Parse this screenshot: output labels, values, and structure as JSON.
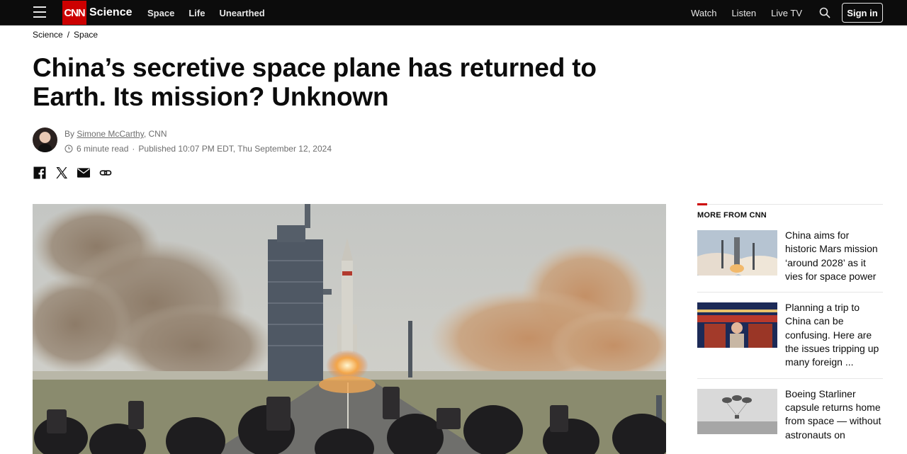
{
  "nav": {
    "logo": "CNN",
    "section": "Science",
    "links": [
      "Space",
      "Life",
      "Unearthed"
    ],
    "right_links": [
      "Watch",
      "Listen",
      "Live TV"
    ],
    "signin": "Sign in"
  },
  "breadcrumb": {
    "items": [
      "Science",
      "Space"
    ],
    "separator": "/"
  },
  "article": {
    "headline": "China’s secretive space plane has returned to Earth. Its mission? Unknown",
    "byline_prefix": "By",
    "author": "Simone McCarthy",
    "outlet": ", CNN",
    "read_time": "6 minute read",
    "separator": "·",
    "published": "Published 10:07 PM EDT, Thu September 12, 2024"
  },
  "share_icons": [
    "facebook-icon",
    "x-icon",
    "email-icon",
    "link-icon"
  ],
  "sidebar": {
    "title": "MORE FROM CNN",
    "items": [
      {
        "title": "China aims for historic Mars mission ‘around 2028’ as it vies for space power"
      },
      {
        "title": "Planning a trip to China can be confusing. Here are the issues tripping up many foreign ..."
      },
      {
        "title": "Boeing Starliner capsule returns home from space — without astronauts on"
      }
    ]
  },
  "colors": {
    "brand": "#cc0000",
    "nav_bg": "#0c0c0c",
    "text": "#0c0c0c",
    "muted": "#6e6e6e"
  }
}
